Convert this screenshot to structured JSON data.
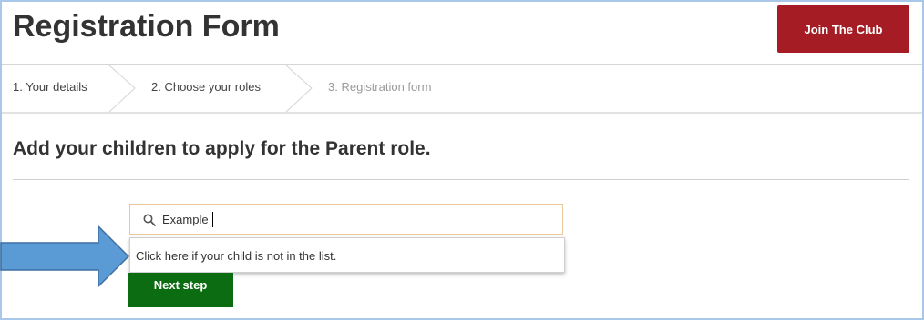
{
  "header": {
    "title": "Registration Form",
    "join_button_label": "Join The Club"
  },
  "steps": [
    {
      "label": "1. Your details",
      "state": "done"
    },
    {
      "label": "2. Choose your roles",
      "state": "current"
    },
    {
      "label": "3. Registration form",
      "state": "upcoming"
    }
  ],
  "section": {
    "title": "Add your children to apply for the Parent role."
  },
  "search": {
    "value": "Example",
    "icon": "search-icon"
  },
  "dropdown": {
    "item_label": "Click here if your child is not in the list."
  },
  "actions": {
    "next_label": "Next step"
  },
  "colors": {
    "brand_red": "#a51c24",
    "next_green": "#0b6c11",
    "annotation_arrow": "#5b9bd5",
    "frame_border": "#a9c7e8"
  }
}
